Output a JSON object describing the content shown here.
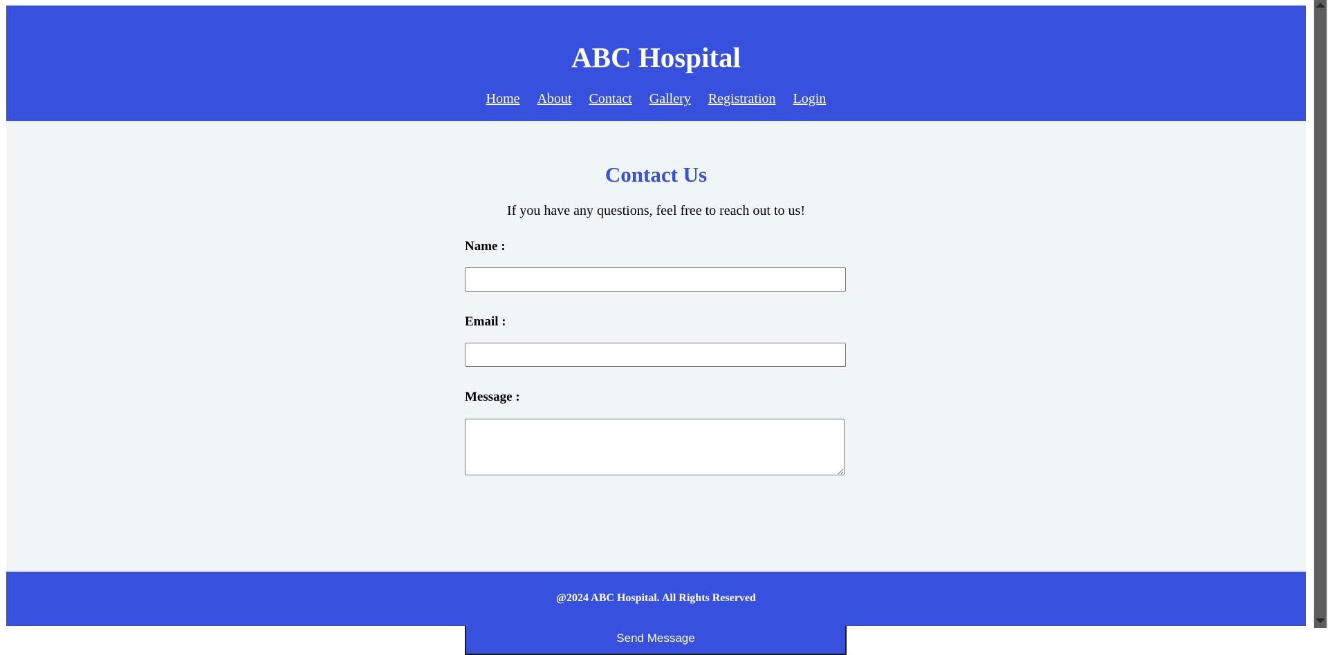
{
  "header": {
    "title": "ABC Hospital",
    "nav": [
      {
        "label": "Home"
      },
      {
        "label": "About"
      },
      {
        "label": "Contact"
      },
      {
        "label": "Gallery"
      },
      {
        "label": "Registration"
      },
      {
        "label": "Login"
      }
    ]
  },
  "contact": {
    "heading": "Contact Us",
    "intro": "If you have any questions, feel free to reach out to us!",
    "name_label": "Name :",
    "name_value": "",
    "email_label": "Email :",
    "email_value": "",
    "message_label": "Message :",
    "message_value": "",
    "submit_label": "Send Message"
  },
  "footer": {
    "text": "@2024 ABC Hospital. All Rights Reserved"
  },
  "colors": {
    "brand": "#3751de",
    "page_background": "#f0f6f6",
    "text_on_brand": "#ffffff"
  },
  "icons": {
    "scroll_up": "chevron-up-icon",
    "scroll_down": "chevron-down-icon"
  }
}
